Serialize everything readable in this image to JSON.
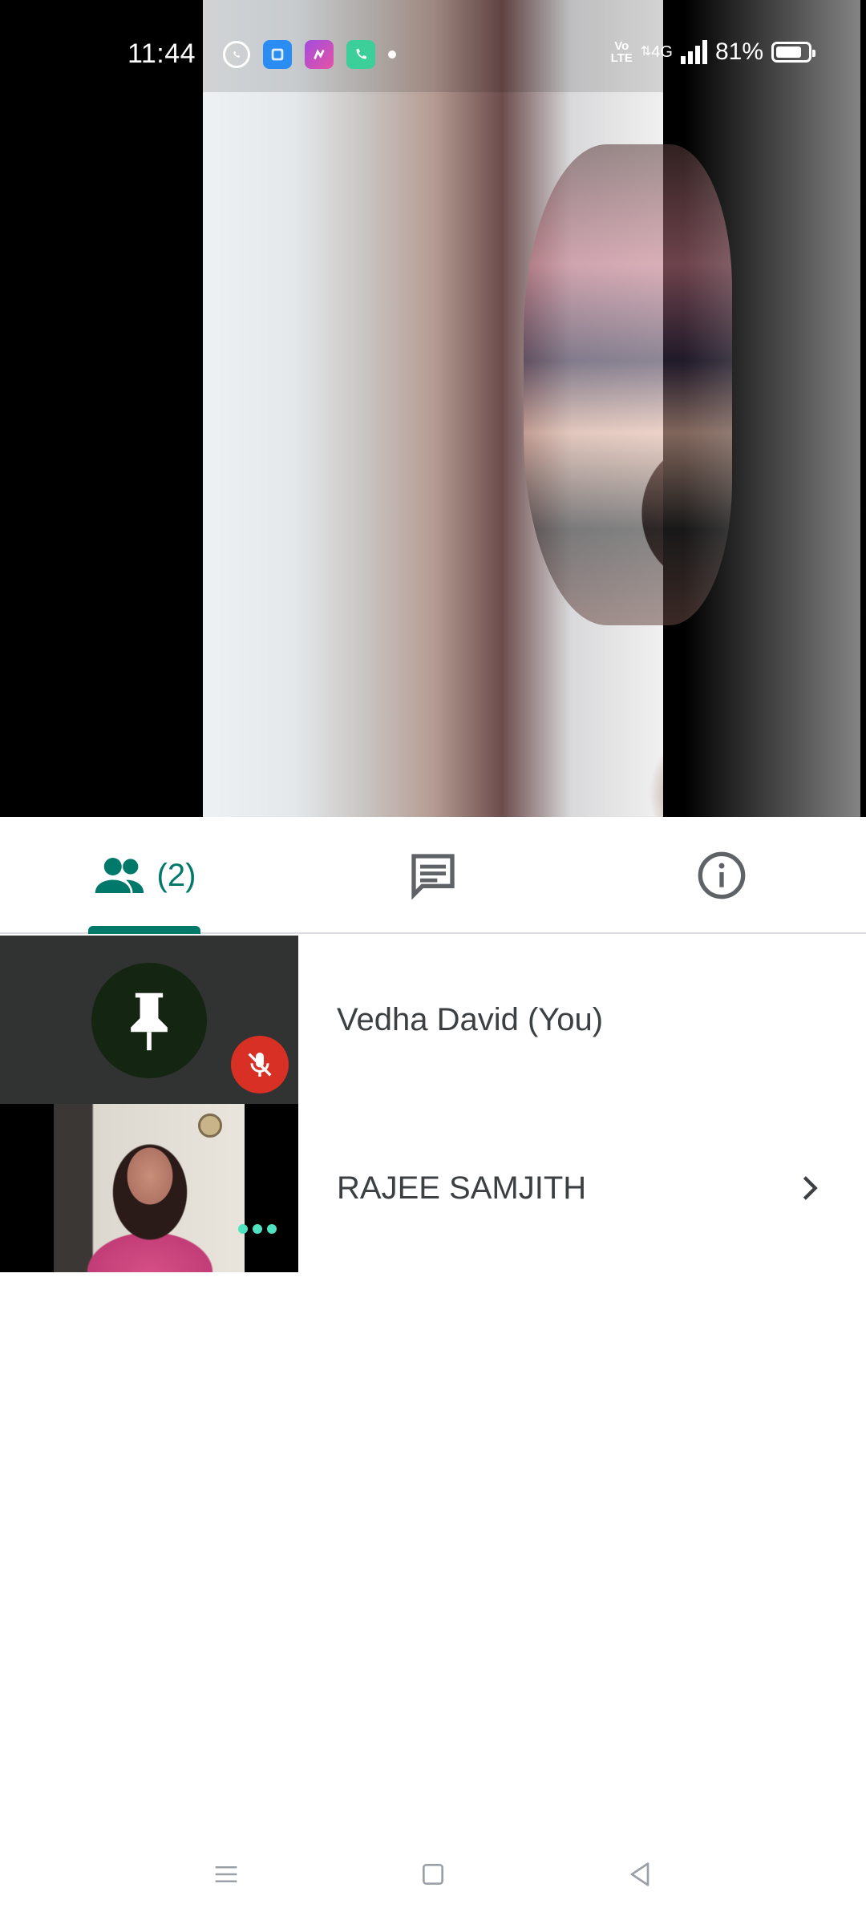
{
  "status_bar": {
    "time": "11:44",
    "notification_icons": [
      "whatsapp-icon",
      "blue-app-icon",
      "purple-app-icon",
      "phone-app-icon",
      "dot-indicator"
    ],
    "volte_line1": "Vo",
    "volte_line2": "LTE",
    "network": "4G",
    "battery_percent": "81%",
    "battery_level": 0.81
  },
  "video": {
    "main_feed": "group-selfie-video"
  },
  "tabs": {
    "people_count": "(2)",
    "active": "people",
    "accent_color": "#00796b",
    "items": [
      "people-tab",
      "chat-tab",
      "info-tab"
    ]
  },
  "participants": [
    {
      "name": "Vedha David (You)",
      "pinned": true,
      "muted": true
    },
    {
      "name": "RAJEE SAMJITH",
      "has_video": true
    }
  ],
  "colors": {
    "mute_red": "#d93025",
    "more_dots": "#4fe3c1"
  },
  "nav_bar": [
    "menu-icon",
    "home-icon",
    "back-icon"
  ]
}
